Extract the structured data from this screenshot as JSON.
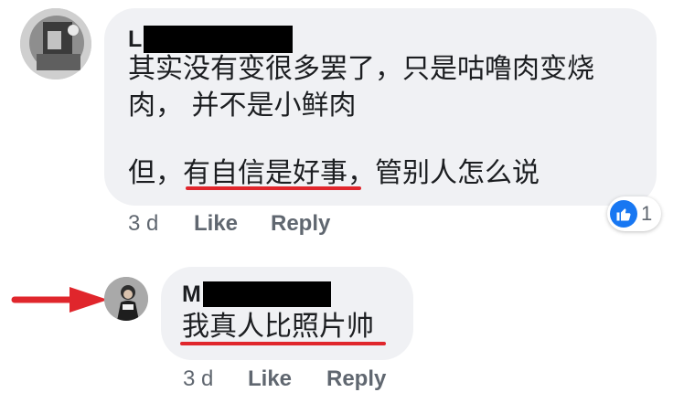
{
  "comment": {
    "author_visible": "L",
    "lines": [
      "其实没有变很多罢了，只是咕噜肉变烧",
      "肉，  并不是小鲜肉",
      "但，有自信是好事，管别人怎么说"
    ],
    "time": "3 d",
    "like_label": "Like",
    "reply_label": "Reply",
    "reaction_count": "1"
  },
  "reply": {
    "author_visible": "M",
    "text": "我真人比照片帅",
    "time": "3 d",
    "like_label": "Like",
    "reply_label": "Reply"
  },
  "colors": {
    "bubble": "#f0f1f4",
    "annotation": "#e0262c",
    "reaction_blue": "#1877f2",
    "meta_text": "#606770"
  }
}
